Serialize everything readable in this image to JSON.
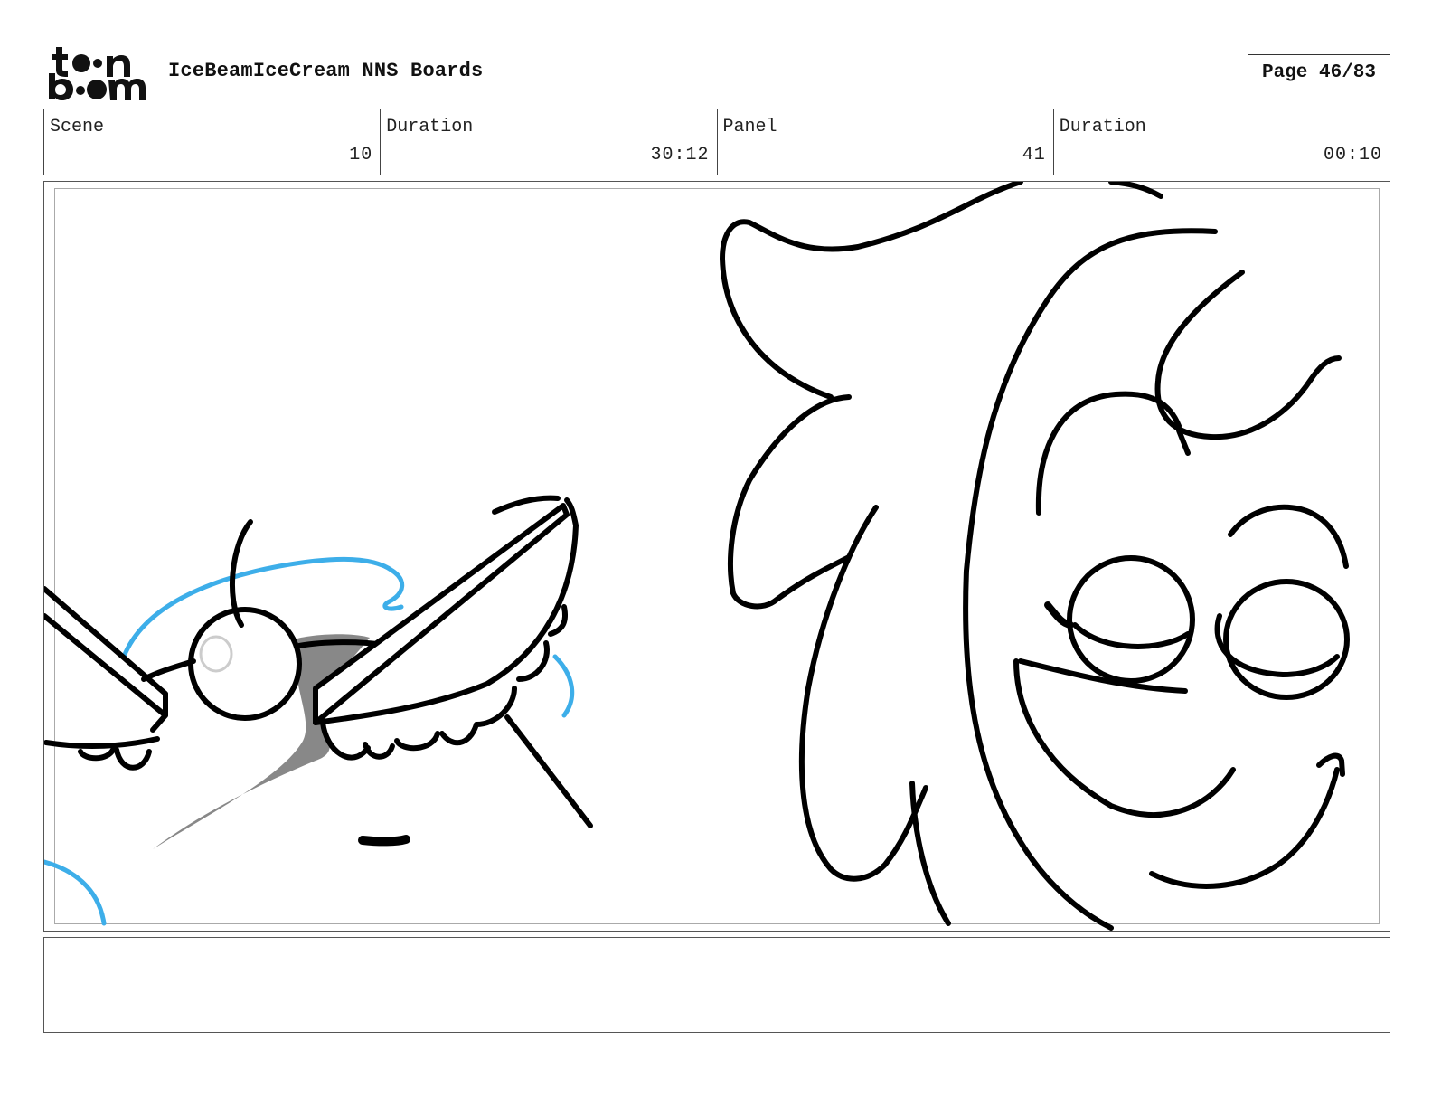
{
  "header": {
    "logo_text_top": "toon",
    "logo_text_bottom": "boom",
    "title": "IceBeamIceCream NNS Boards",
    "page_label": "Page 46/83"
  },
  "info": [
    {
      "label": "Scene",
      "value": "10"
    },
    {
      "label": "Duration",
      "value": "30:12"
    },
    {
      "label": "Panel",
      "value": "41"
    },
    {
      "label": "Duration",
      "value": "00:10"
    }
  ],
  "panel": {
    "ink_color": "#000000",
    "construction_color": "#3daee9",
    "shadow_color": "#888888"
  },
  "notes": {
    "text": ""
  }
}
